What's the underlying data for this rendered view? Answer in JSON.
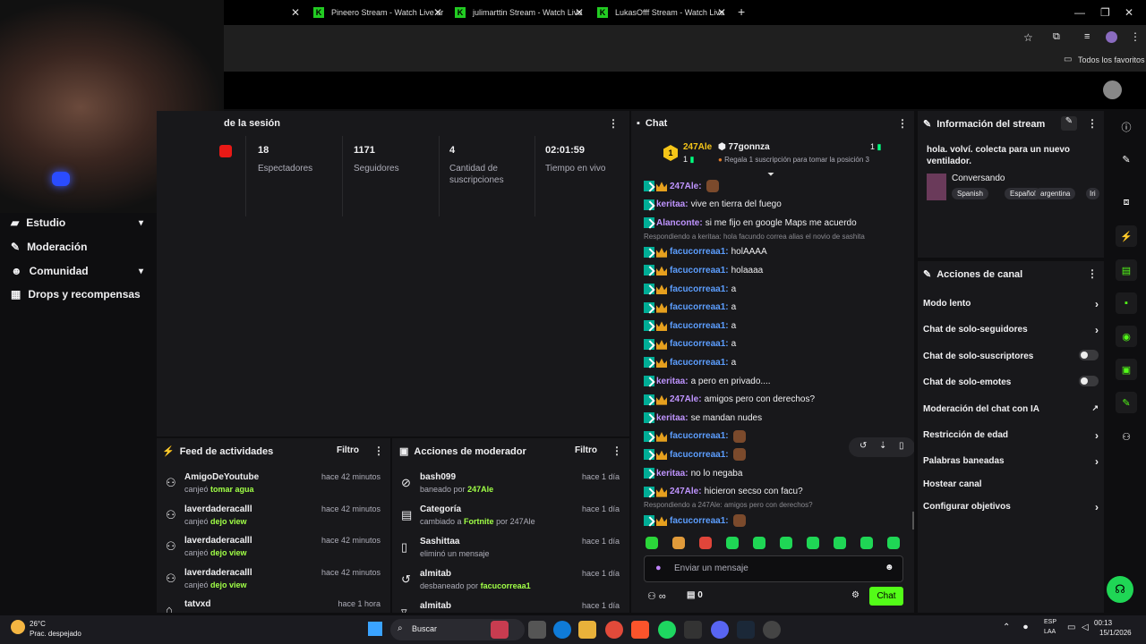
{
  "browser": {
    "tabs": [
      {
        "label": "Pineero Stream - Watch Live or"
      },
      {
        "label": "julimarttin Stream - Watch Live"
      },
      {
        "label": "LukasOfff Stream - Watch Live"
      }
    ],
    "bookmarks_label": "Todos los favoritos"
  },
  "stats": {
    "title": "de la sesión",
    "items": [
      {
        "value": "18",
        "label": "Espectadores"
      },
      {
        "value": "1171",
        "label": "Seguidores"
      },
      {
        "value": "4",
        "label": "Cantidad de suscripciones"
      },
      {
        "value": "02:01:59",
        "label": "Tiempo en vivo"
      }
    ]
  },
  "sidebar": {
    "items": [
      {
        "label": "Estudio"
      },
      {
        "label": "Moderación"
      },
      {
        "label": "Comunidad"
      },
      {
        "label": "Drops y recompensas"
      }
    ]
  },
  "feed": {
    "title": "Feed de actividades",
    "filter": "Filtro",
    "rows": [
      {
        "name": "AmigoDeYoutube",
        "action": "canjeó",
        "reward": "tomar agua",
        "time": "hace 42 minutos"
      },
      {
        "name": "laverdaderacalll",
        "action": "canjeó",
        "reward": "dejo view",
        "time": "hace 42 minutos"
      },
      {
        "name": "laverdaderacalll",
        "action": "canjeó",
        "reward": "dejo view",
        "time": "hace 42 minutos"
      },
      {
        "name": "laverdaderacalll",
        "action": "canjeó",
        "reward": "dejo view",
        "time": "hace 42 minutos"
      },
      {
        "name": "tatvxd",
        "action": "",
        "reward": "",
        "time": "hace 1 hora"
      }
    ]
  },
  "modactions": {
    "title": "Acciones de moderador",
    "filter": "Filtro",
    "rows": [
      {
        "name": "bash099",
        "sub": "baneado por",
        "who": "247Ale",
        "extra": "",
        "time": "hace 1 día"
      },
      {
        "name": "Categoría",
        "sub": "cambiado a",
        "who": "Fortnite",
        "extra": "por 247Ale",
        "time": "hace 1 día"
      },
      {
        "name": "Sashittaa",
        "sub": "eliminó un mensaje",
        "who": "",
        "extra": "",
        "time": "hace 1 día"
      },
      {
        "name": "almitab",
        "sub": "desbaneado por",
        "who": "facucorreaa1",
        "extra": "",
        "time": "hace 1 día"
      },
      {
        "name": "almitab",
        "sub": "",
        "who": "",
        "extra": "",
        "time": "hace 1 día"
      }
    ]
  },
  "chat": {
    "title": "Chat",
    "leader": {
      "name": "247Ale",
      "count": "1",
      "gifter": "77gonnza",
      "gift_count": "1",
      "gift_text": "Regala 1 suscripción para tomar la posición 3"
    },
    "messages": [
      {
        "user": "247Ale",
        "text": "",
        "color": "#bf94ff",
        "badges": "mc",
        "emote": true
      },
      {
        "user": "keritaa",
        "text": "vive en tierra del fuego",
        "color": "#bf94ff",
        "badges": "m",
        "emote": false
      },
      {
        "user": "Alanconte",
        "text": "si me fijo en google Maps me acuerdo",
        "color": "#bf94ff",
        "badges": "m",
        "emote": false
      },
      {
        "reply": "Respondiendo a keritaa: hola facundo correa alias el novio de sashita"
      },
      {
        "user": "facucorreaa1",
        "text": "holAAAA",
        "color": "#5c9eff",
        "badges": "mc",
        "emote": false
      },
      {
        "user": "facucorreaa1",
        "text": "holaaaa",
        "color": "#5c9eff",
        "badges": "mc",
        "emote": false
      },
      {
        "user": "facucorreaa1",
        "text": "a",
        "color": "#5c9eff",
        "badges": "mc",
        "emote": false
      },
      {
        "user": "facucorreaa1",
        "text": "a",
        "color": "#5c9eff",
        "badges": "mc",
        "emote": false
      },
      {
        "user": "facucorreaa1",
        "text": "a",
        "color": "#5c9eff",
        "badges": "mc",
        "emote": false
      },
      {
        "user": "facucorreaa1",
        "text": "a",
        "color": "#5c9eff",
        "badges": "mc",
        "emote": false
      },
      {
        "user": "facucorreaa1",
        "text": "a",
        "color": "#5c9eff",
        "badges": "mc",
        "emote": false
      },
      {
        "user": "keritaa",
        "text": "a pero en privado....",
        "color": "#bf94ff",
        "badges": "m",
        "emote": false
      },
      {
        "user": "247Ale",
        "text": "amigos pero con derechos?",
        "color": "#bf94ff",
        "badges": "mc",
        "emote": false
      },
      {
        "user": "keritaa",
        "text": "se mandan nudes",
        "color": "#bf94ff",
        "badges": "m",
        "emote": false
      },
      {
        "user": "facucorreaa1",
        "text": "",
        "color": "#5c9eff",
        "badges": "mc",
        "emote": true
      },
      {
        "user": "facucorreaa1",
        "text": "",
        "color": "#5c9eff",
        "badges": "mc",
        "emote": true
      },
      {
        "user": "keritaa",
        "text": "no lo negaba",
        "color": "#bf94ff",
        "badges": "m",
        "emote": false
      },
      {
        "user": "247Ale",
        "text": "hicieron secso con facu?",
        "color": "#bf94ff",
        "badges": "mc",
        "emote": false
      },
      {
        "reply": "Respondiendo a 247Ale: amigos pero con derechos?"
      },
      {
        "user": "facucorreaa1",
        "text": "",
        "color": "#5c9eff",
        "badges": "mc",
        "emote": true
      }
    ],
    "input_placeholder": "Enviar un mensaje",
    "points": "0",
    "send_label": "Chat"
  },
  "streaminfo": {
    "title": "Información del stream",
    "description": "hola. volví. colecta para un nuevo ventilador.",
    "category": "Conversando",
    "tags": [
      "Spanish",
      "Español",
      "argentina",
      "Iri"
    ]
  },
  "channel_actions": {
    "title": "Acciones de canal",
    "items": [
      {
        "label": "Modo lento",
        "type": "arrow"
      },
      {
        "label": "Chat de solo-seguidores",
        "type": "arrow"
      },
      {
        "label": "Chat de solo-suscriptores",
        "type": "toggle"
      },
      {
        "label": "Chat de solo-emotes",
        "type": "toggle"
      },
      {
        "label": "Moderación del chat con IA",
        "type": "link"
      },
      {
        "label": "Restricción de edad",
        "type": "arrow"
      },
      {
        "label": "Palabras baneadas",
        "type": "arrow"
      },
      {
        "label": "Hostear canal",
        "type": "none"
      },
      {
        "label": "Configurar objetivos",
        "type": "arrow"
      }
    ]
  },
  "taskbar": {
    "weather_temp": "26°C",
    "weather_desc": "Prac. despejado",
    "search": "Buscar",
    "lang1": "ESP",
    "lang2": "LAA",
    "time": "00:13",
    "date": "15/1/2026"
  },
  "colors": {
    "accent": "#53fc18",
    "mod_badge": "#00ad96",
    "panel": "#18181b"
  }
}
